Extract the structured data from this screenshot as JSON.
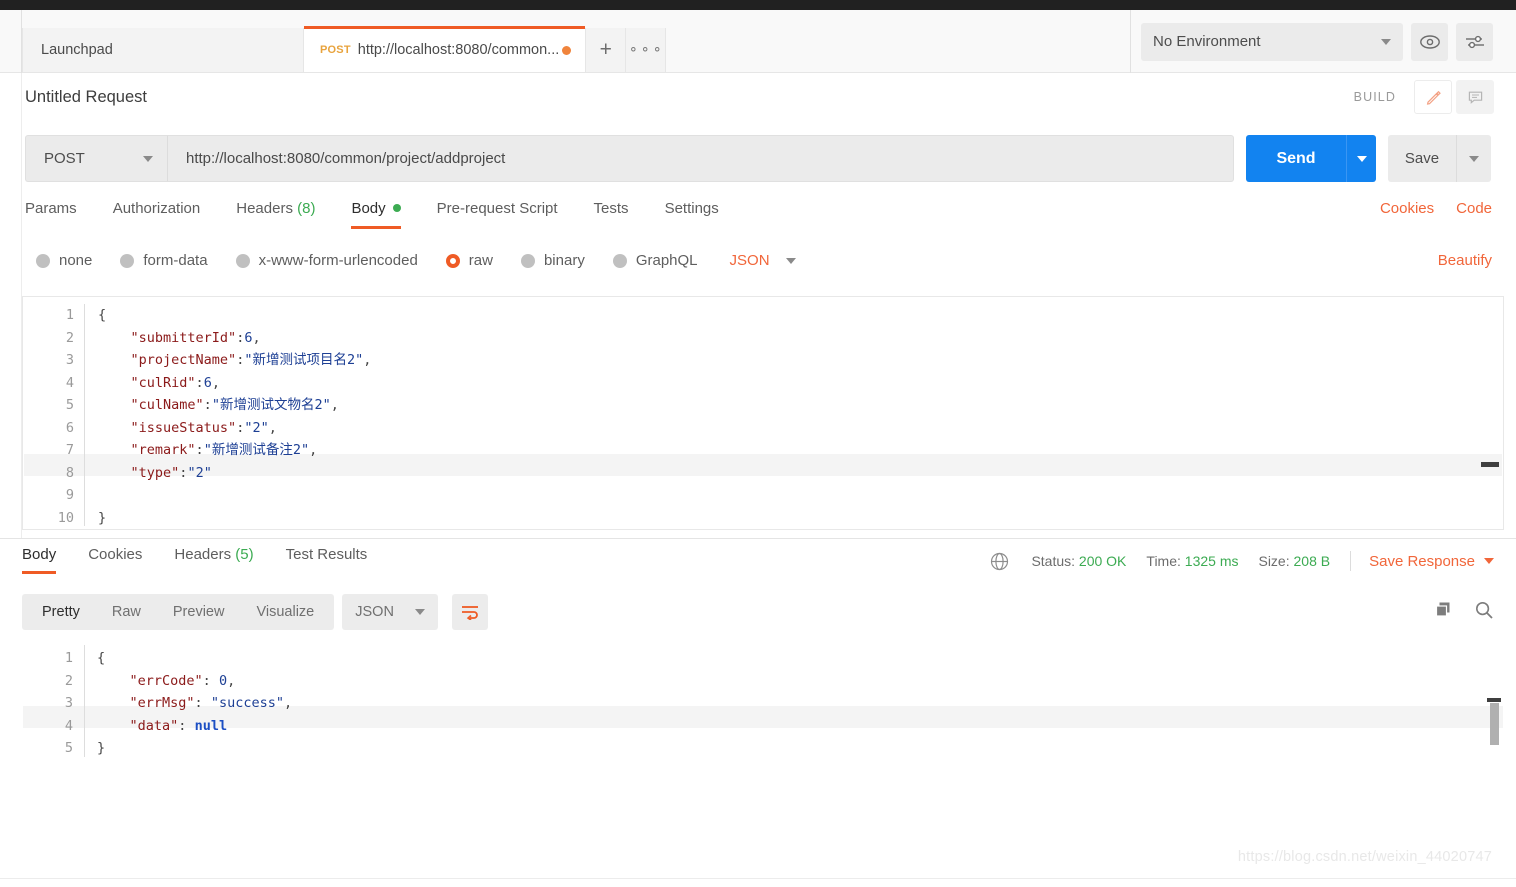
{
  "tabs": {
    "launchpad_label": "Launchpad",
    "active_tab": {
      "method": "POST",
      "url_short": "http://localhost:8080/common...",
      "unsaved": true
    },
    "new_tab_label": "+",
    "more_label": "000"
  },
  "environment": {
    "selected": "No Environment",
    "eye_icon": "eye-icon",
    "settings_icon": "sliders-icon"
  },
  "request": {
    "title": "Untitled Request",
    "build_label": "BUILD",
    "method": "POST",
    "url": "http://localhost:8080/common/project/addproject",
    "send_label": "Send",
    "save_label": "Save",
    "tabs": [
      {
        "label": "Params",
        "count": "",
        "active": false
      },
      {
        "label": "Authorization",
        "count": "",
        "active": false
      },
      {
        "label": "Headers",
        "count": "(8)",
        "active": false
      },
      {
        "label": "Body",
        "count": "",
        "active": true
      },
      {
        "label": "Pre-request Script",
        "count": "",
        "active": false
      },
      {
        "label": "Tests",
        "count": "",
        "active": false
      },
      {
        "label": "Settings",
        "count": "",
        "active": false
      }
    ],
    "links": {
      "cookies": "Cookies",
      "code": "Code",
      "beautify": "Beautify"
    },
    "body_types": [
      {
        "label": "none",
        "selected": false
      },
      {
        "label": "form-data",
        "selected": false
      },
      {
        "label": "x-www-form-urlencoded",
        "selected": false
      },
      {
        "label": "raw",
        "selected": true
      },
      {
        "label": "binary",
        "selected": false
      },
      {
        "label": "GraphQL",
        "selected": false
      }
    ],
    "raw_format": "JSON",
    "body_lines": [
      {
        "n": "1",
        "tokens": [
          {
            "t": "{",
            "c": "p"
          }
        ]
      },
      {
        "n": "2",
        "tokens": [
          {
            "t": "    ",
            "c": "p"
          },
          {
            "t": "\"submitterId\"",
            "c": "k"
          },
          {
            "t": ":",
            "c": "p"
          },
          {
            "t": "6",
            "c": "n"
          },
          {
            "t": ",",
            "c": "p"
          }
        ]
      },
      {
        "n": "3",
        "tokens": [
          {
            "t": "    ",
            "c": "p"
          },
          {
            "t": "\"projectName\"",
            "c": "k"
          },
          {
            "t": ":",
            "c": "p"
          },
          {
            "t": "\"新增测试项目名2\"",
            "c": "s"
          },
          {
            "t": ",",
            "c": "p"
          }
        ]
      },
      {
        "n": "4",
        "tokens": [
          {
            "t": "    ",
            "c": "p"
          },
          {
            "t": "\"culRid\"",
            "c": "k"
          },
          {
            "t": ":",
            "c": "p"
          },
          {
            "t": "6",
            "c": "n"
          },
          {
            "t": ",",
            "c": "p"
          }
        ]
      },
      {
        "n": "5",
        "tokens": [
          {
            "t": "    ",
            "c": "p"
          },
          {
            "t": "\"culName\"",
            "c": "k"
          },
          {
            "t": ":",
            "c": "p"
          },
          {
            "t": "\"新增测试文物名2\"",
            "c": "s"
          },
          {
            "t": ",",
            "c": "p"
          }
        ]
      },
      {
        "n": "6",
        "tokens": [
          {
            "t": "    ",
            "c": "p"
          },
          {
            "t": "\"issueStatus\"",
            "c": "k"
          },
          {
            "t": ":",
            "c": "p"
          },
          {
            "t": "\"2\"",
            "c": "s"
          },
          {
            "t": ",",
            "c": "p"
          }
        ]
      },
      {
        "n": "7",
        "tokens": [
          {
            "t": "    ",
            "c": "p"
          },
          {
            "t": "\"remark\"",
            "c": "k"
          },
          {
            "t": ":",
            "c": "p"
          },
          {
            "t": "\"新增测试备注2\"",
            "c": "s"
          },
          {
            "t": ",",
            "c": "p"
          }
        ]
      },
      {
        "n": "8",
        "tokens": [
          {
            "t": "    ",
            "c": "p"
          },
          {
            "t": "\"type\"",
            "c": "k"
          },
          {
            "t": ":",
            "c": "p"
          },
          {
            "t": "\"2\"",
            "c": "s"
          }
        ]
      },
      {
        "n": "9",
        "tokens": []
      },
      {
        "n": "10",
        "tokens": [
          {
            "t": "}",
            "c": "p"
          }
        ]
      }
    ]
  },
  "response": {
    "tabs": [
      {
        "label": "Body",
        "count": "",
        "active": true
      },
      {
        "label": "Cookies",
        "count": "",
        "active": false
      },
      {
        "label": "Headers",
        "count": "(5)",
        "active": false
      },
      {
        "label": "Test Results",
        "count": "",
        "active": false
      }
    ],
    "status_label": "Status:",
    "status_value": "200 OK",
    "time_label": "Time:",
    "time_value": "1325 ms",
    "size_label": "Size:",
    "size_value": "208 B",
    "save_response_label": "Save Response",
    "view_modes": [
      {
        "label": "Pretty",
        "active": true
      },
      {
        "label": "Raw",
        "active": false
      },
      {
        "label": "Preview",
        "active": false
      },
      {
        "label": "Visualize",
        "active": false
      }
    ],
    "format": "JSON",
    "wrap_icon": "word-wrap-icon",
    "copy_icon": "copy-icon",
    "search_icon": "search-icon",
    "body_lines": [
      {
        "n": "1",
        "tokens": [
          {
            "t": "{",
            "c": "p"
          }
        ]
      },
      {
        "n": "2",
        "tokens": [
          {
            "t": "    ",
            "c": "p"
          },
          {
            "t": "\"errCode\"",
            "c": "k"
          },
          {
            "t": ": ",
            "c": "p"
          },
          {
            "t": "0",
            "c": "n"
          },
          {
            "t": ",",
            "c": "p"
          }
        ]
      },
      {
        "n": "3",
        "tokens": [
          {
            "t": "    ",
            "c": "p"
          },
          {
            "t": "\"errMsg\"",
            "c": "k"
          },
          {
            "t": ": ",
            "c": "p"
          },
          {
            "t": "\"success\"",
            "c": "s"
          },
          {
            "t": ",",
            "c": "p"
          }
        ]
      },
      {
        "n": "4",
        "tokens": [
          {
            "t": "    ",
            "c": "p"
          },
          {
            "t": "\"data\"",
            "c": "k"
          },
          {
            "t": ": ",
            "c": "p"
          },
          {
            "t": "null",
            "c": "nul"
          }
        ]
      },
      {
        "n": "5",
        "tokens": [
          {
            "t": "}",
            "c": "p"
          }
        ]
      }
    ]
  },
  "watermark": "https://blog.csdn.net/weixin_44020747",
  "colors": {
    "accent_orange": "#ef5b25",
    "send_blue": "#1283f0",
    "success_green": "#3cab52",
    "method_amber": "#e8a33d"
  }
}
